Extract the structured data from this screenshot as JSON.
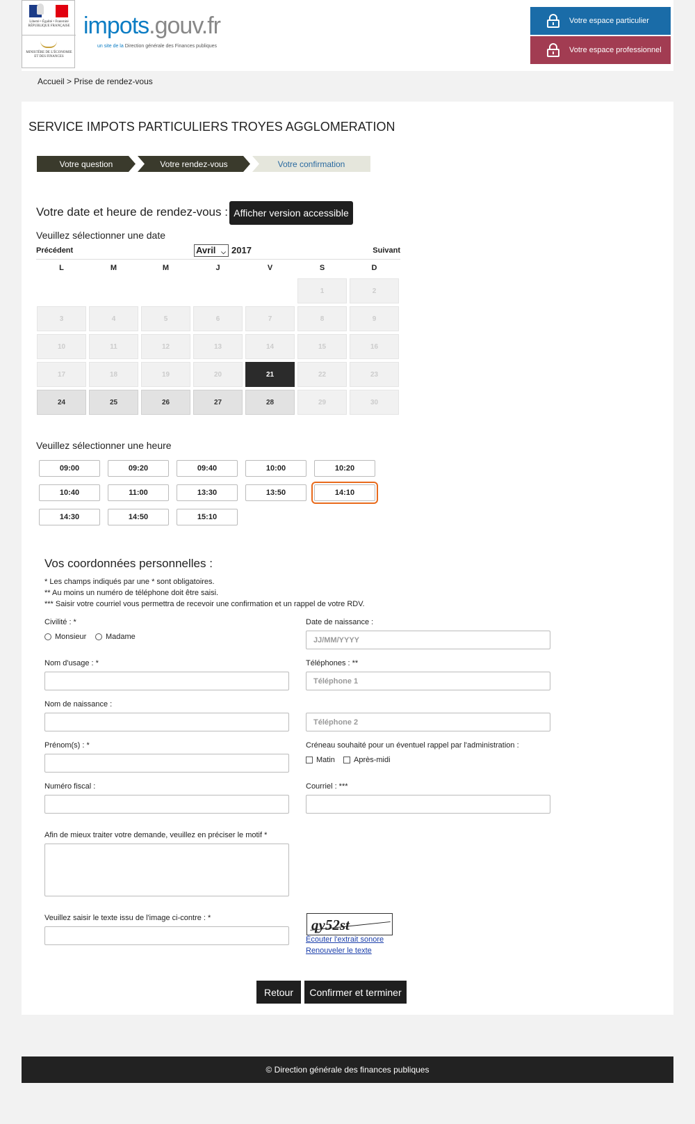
{
  "header": {
    "logo_rf_motto": "Liberté • Égalité • Fraternité",
    "logo_rf_name": "RÉPUBLIQUE FRANÇAISE",
    "logo_ministry": "MINISTÈRE DE L'ÉCONOMIE ET DES FINANCES",
    "brand_blue": "impots",
    "brand_grey": ".gouv.fr",
    "brand_sub_prefix": "un site de la",
    "brand_sub": "Direction générale des Finances publiques",
    "espace_particulier": "Votre espace particulier",
    "espace_professionnel": "Votre espace professionnel"
  },
  "breadcrumb": {
    "home": "Accueil",
    "sep": ">",
    "current": "Prise de rendez-vous"
  },
  "service_title": "SERVICE IMPOTS PARTICULIERS TROYES AGGLOMERATION",
  "steps": [
    "Votre question",
    "Votre rendez-vous",
    "Votre confirmation"
  ],
  "rdv": {
    "label": "Votre date et heure de rendez-vous :",
    "accessible_button": "Afficher version accessible"
  },
  "calendar": {
    "select_label": "Veuillez sélectionner une date",
    "prev": "Précédent",
    "next": "Suivant",
    "month": "Avril",
    "year": "2017",
    "weekdays": [
      "L",
      "M",
      "M",
      "J",
      "V",
      "S",
      "D"
    ],
    "weeks": [
      [
        "",
        "",
        "",
        "",
        "",
        "1",
        "2"
      ],
      [
        "3",
        "4",
        "5",
        "6",
        "7",
        "8",
        "9"
      ],
      [
        "10",
        "11",
        "12",
        "13",
        "14",
        "15",
        "16"
      ],
      [
        "17",
        "18",
        "19",
        "20",
        "21",
        "22",
        "23"
      ],
      [
        "24",
        "25",
        "26",
        "27",
        "28",
        "29",
        "30"
      ]
    ],
    "available": [
      "24",
      "25",
      "26",
      "27",
      "28"
    ],
    "selected": "21"
  },
  "times": {
    "select_label": "Veuillez sélectionner une heure",
    "slots": [
      "09:00",
      "09:20",
      "09:40",
      "10:00",
      "10:20",
      "10:40",
      "11:00",
      "13:30",
      "13:50",
      "14:10",
      "14:30",
      "14:50",
      "15:10"
    ],
    "highlighted": "14:10",
    "highlight_color": "#e86a1c"
  },
  "form": {
    "title": "Vos coordonnées personnelles :",
    "notes": [
      "* Les champs indiqués par une * sont obligatoires.",
      "** Au moins un numéro de téléphone doit être saisi.",
      "*** Saisir votre courriel vous permettra de recevoir une confirmation et un rappel de votre RDV."
    ],
    "civilite_label": "Civilité : *",
    "monsieur": "Monsieur",
    "madame": "Madame",
    "birthdate_label": "Date de naissance :",
    "birthdate_placeholder": "JJ/MM/YYYY",
    "nom_usage_label": "Nom d'usage : *",
    "telephones_label": "Téléphones : **",
    "tel1_placeholder": "Téléphone 1",
    "nom_naissance_label": "Nom de naissance :",
    "tel2_placeholder": "Téléphone 2",
    "prenoms_label": "Prénom(s) : *",
    "creneau_label": "Créneau souhaité pour un éventuel rappel par l'administration :",
    "matin": "Matin",
    "apres_midi": "Après-midi",
    "numero_fiscal_label": "Numéro fiscal :",
    "courriel_label": "Courriel : ***",
    "motif_label": "Afin de mieux traiter votre demande, veuillez en préciser le motif *",
    "captcha_label": "Veuillez saisir le texte issu de l'image ci-contre : *",
    "captcha_text": "qy52st",
    "listen_link": "Écouter l'extrait sonore",
    "renew_link": "Renouveler le texte",
    "retour": "Retour",
    "confirm": "Confirmer et terminer"
  },
  "footer": "© Direction générale des finances publiques",
  "colors": {
    "particulier": "#1a6ca8",
    "professionnel": "#a23c52",
    "step_dark": "#3a3a2c",
    "step_light": "#e5e6dc"
  }
}
